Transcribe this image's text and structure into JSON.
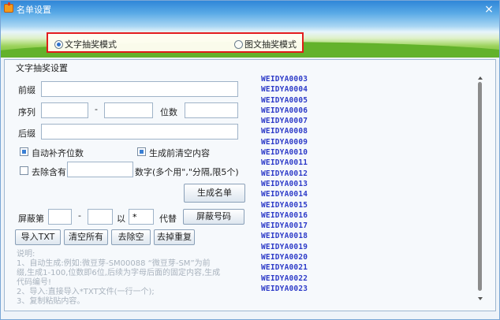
{
  "window": {
    "title": "名单设置",
    "close_symbol": "×"
  },
  "mode": {
    "text_mode_label": "文字抽奖模式",
    "image_mode_label": "图文抽奖模式",
    "selected": "text"
  },
  "panel": {
    "title": "文字抽奖设置"
  },
  "fields": {
    "prefix_label": "前缀",
    "prefix_value": "",
    "sequence_label": "序列",
    "sequence_from": "",
    "sequence_dash": "-",
    "sequence_to": "",
    "digits_label": "位数",
    "digits_value": "",
    "suffix_label": "后缀",
    "suffix_value": ""
  },
  "options": {
    "auto_pad_label": "自动补齐位数",
    "auto_pad_checked": true,
    "clear_before_label": "生成前清空内容",
    "clear_before_checked": true,
    "remove_label": "去除含有",
    "remove_checked": false,
    "remove_value": "",
    "remove_hint": "数字(多个用\",\"分隔,限5个)"
  },
  "generate_button": "生成名单",
  "mask": {
    "label": "屏蔽第",
    "from": "",
    "dash": "-",
    "to": "",
    "with_label": "以",
    "with_value": "*",
    "replace_label": "代替",
    "button": "屏蔽号码"
  },
  "actions": {
    "import_txt": "导入TXT",
    "clear_all": "清空所有",
    "remove_blank": "去除空",
    "remove_duplicate": "去掉重复"
  },
  "notes": [
    "说明:",
    "1、自动生成:例如:微豆芽-SM00088  “微豆芽-SM”为前",
    "缀,生成1-100,位数即6位,后续为字母后面的固定内容,生成",
    "代码编号!",
    "2、导入:直接导入*TXT文件(一行一个);",
    "3、复制粘贴内容。"
  ],
  "list": [
    "WEIDYA0003",
    "WEIDYA0004",
    "WEIDYA0005",
    "WEIDYA0006",
    "WEIDYA0007",
    "WEIDYA0008",
    "WEIDYA0009",
    "WEIDYA0010",
    "WEIDYA0011",
    "WEIDYA0012",
    "WEIDYA0013",
    "WEIDYA0014",
    "WEIDYA0015",
    "WEIDYA0016",
    "WEIDYA0017",
    "WEIDYA0018",
    "WEIDYA0019",
    "WEIDYA0020",
    "WEIDYA0021",
    "WEIDYA0022",
    "WEIDYA0023"
  ],
  "colors": {
    "list_text": "#2d3bc8",
    "highlight_border": "#e3171a"
  }
}
